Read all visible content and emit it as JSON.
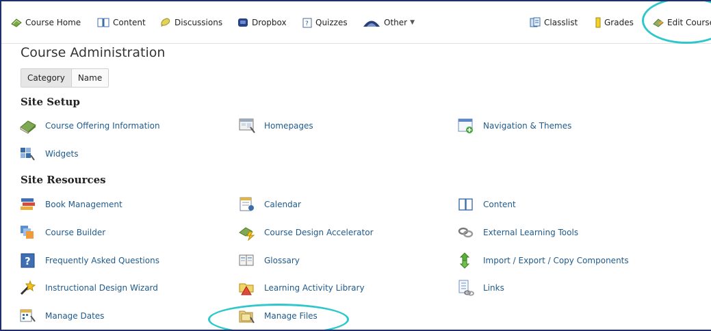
{
  "nav": {
    "items": [
      {
        "label": "Course Home"
      },
      {
        "label": "Content"
      },
      {
        "label": "Discussions"
      },
      {
        "label": "Dropbox"
      },
      {
        "label": "Quizzes"
      },
      {
        "label": "Other"
      },
      {
        "label": "Classlist"
      },
      {
        "label": "Grades"
      },
      {
        "label": "Edit Course"
      }
    ]
  },
  "page": {
    "title": "Course Administration",
    "view_toggle": {
      "category": "Category",
      "name": "Name",
      "selected": "Category"
    }
  },
  "sections": [
    {
      "heading": "Site Setup",
      "links": [
        {
          "label": "Course Offering Information",
          "icon": "book-icon"
        },
        {
          "label": "Homepages",
          "icon": "homepage-icon"
        },
        {
          "label": "Navigation & Themes",
          "icon": "navigation-icon"
        },
        {
          "label": "Widgets",
          "icon": "widget-icon"
        }
      ]
    },
    {
      "heading": "Site Resources",
      "links": [
        {
          "label": "Book Management",
          "icon": "books-icon"
        },
        {
          "label": "Calendar",
          "icon": "calendar-icon"
        },
        {
          "label": "Content",
          "icon": "content-book-icon"
        },
        {
          "label": "Course Builder",
          "icon": "builder-icon"
        },
        {
          "label": "Course Design Accelerator",
          "icon": "accelerator-icon"
        },
        {
          "label": "External Learning Tools",
          "icon": "chain-link-icon"
        },
        {
          "label": "Frequently Asked Questions",
          "icon": "question-icon"
        },
        {
          "label": "Glossary",
          "icon": "glossary-icon"
        },
        {
          "label": "Import / Export / Copy Components",
          "icon": "import-export-icon"
        },
        {
          "label": "Instructional Design Wizard",
          "icon": "wizard-icon"
        },
        {
          "label": "Learning Activity Library",
          "icon": "library-icon"
        },
        {
          "label": "Links",
          "icon": "links-icon"
        },
        {
          "label": "Manage Dates",
          "icon": "dates-icon"
        },
        {
          "label": "Manage Files",
          "icon": "folder-icon"
        }
      ]
    }
  ],
  "colors": {
    "link": "#1e5a8c",
    "highlight": "#2ec7cc",
    "frame": "#1f2f6b"
  }
}
